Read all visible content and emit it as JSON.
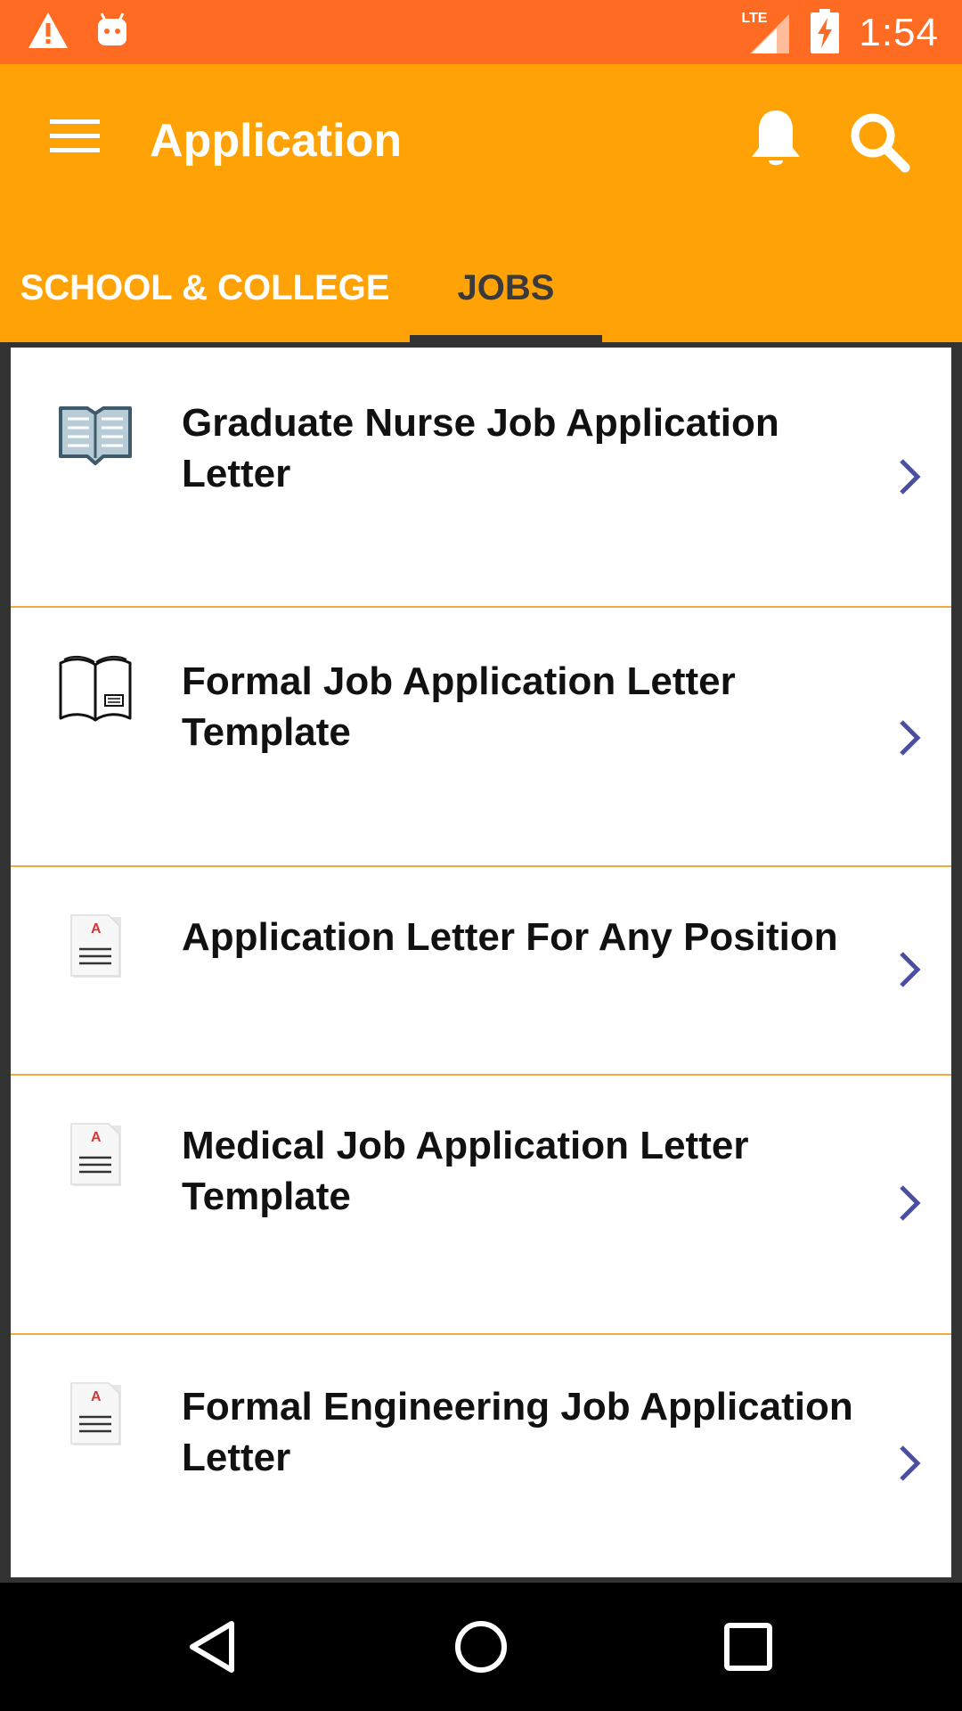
{
  "status_bar": {
    "time": "1:54",
    "network": "LTE",
    "icons": [
      "warning-icon",
      "android-icon",
      "signal-icon",
      "battery-charging-icon"
    ]
  },
  "app_bar": {
    "title": "Application",
    "icons": [
      "menu-icon",
      "bell-icon",
      "search-icon"
    ]
  },
  "tabs": [
    {
      "label": "SCHOOL & COLLEGE",
      "selected": false
    },
    {
      "label": "JOBS",
      "selected": true
    }
  ],
  "list": {
    "items": [
      {
        "title": "Graduate Nurse Job Application Letter",
        "icon": "open-book-icon"
      },
      {
        "title": "Formal Job Application Letter Template",
        "icon": "book-outline-icon"
      },
      {
        "title": "Application Letter For Any Position",
        "icon": "document-icon"
      },
      {
        "title": "Medical Job Application Letter Template",
        "icon": "document-icon"
      },
      {
        "title": "Formal Engineering Job Application Letter",
        "icon": "document-icon"
      }
    ]
  },
  "nav_bar": {
    "icons": [
      "back-icon",
      "home-icon",
      "recents-icon"
    ]
  },
  "colors": {
    "status_bar": "#FF6B22",
    "app_bar": "#FFA205",
    "divider": "#F2A93B",
    "chevron": "#4B4FA0",
    "tab_indicator": "#333333"
  }
}
